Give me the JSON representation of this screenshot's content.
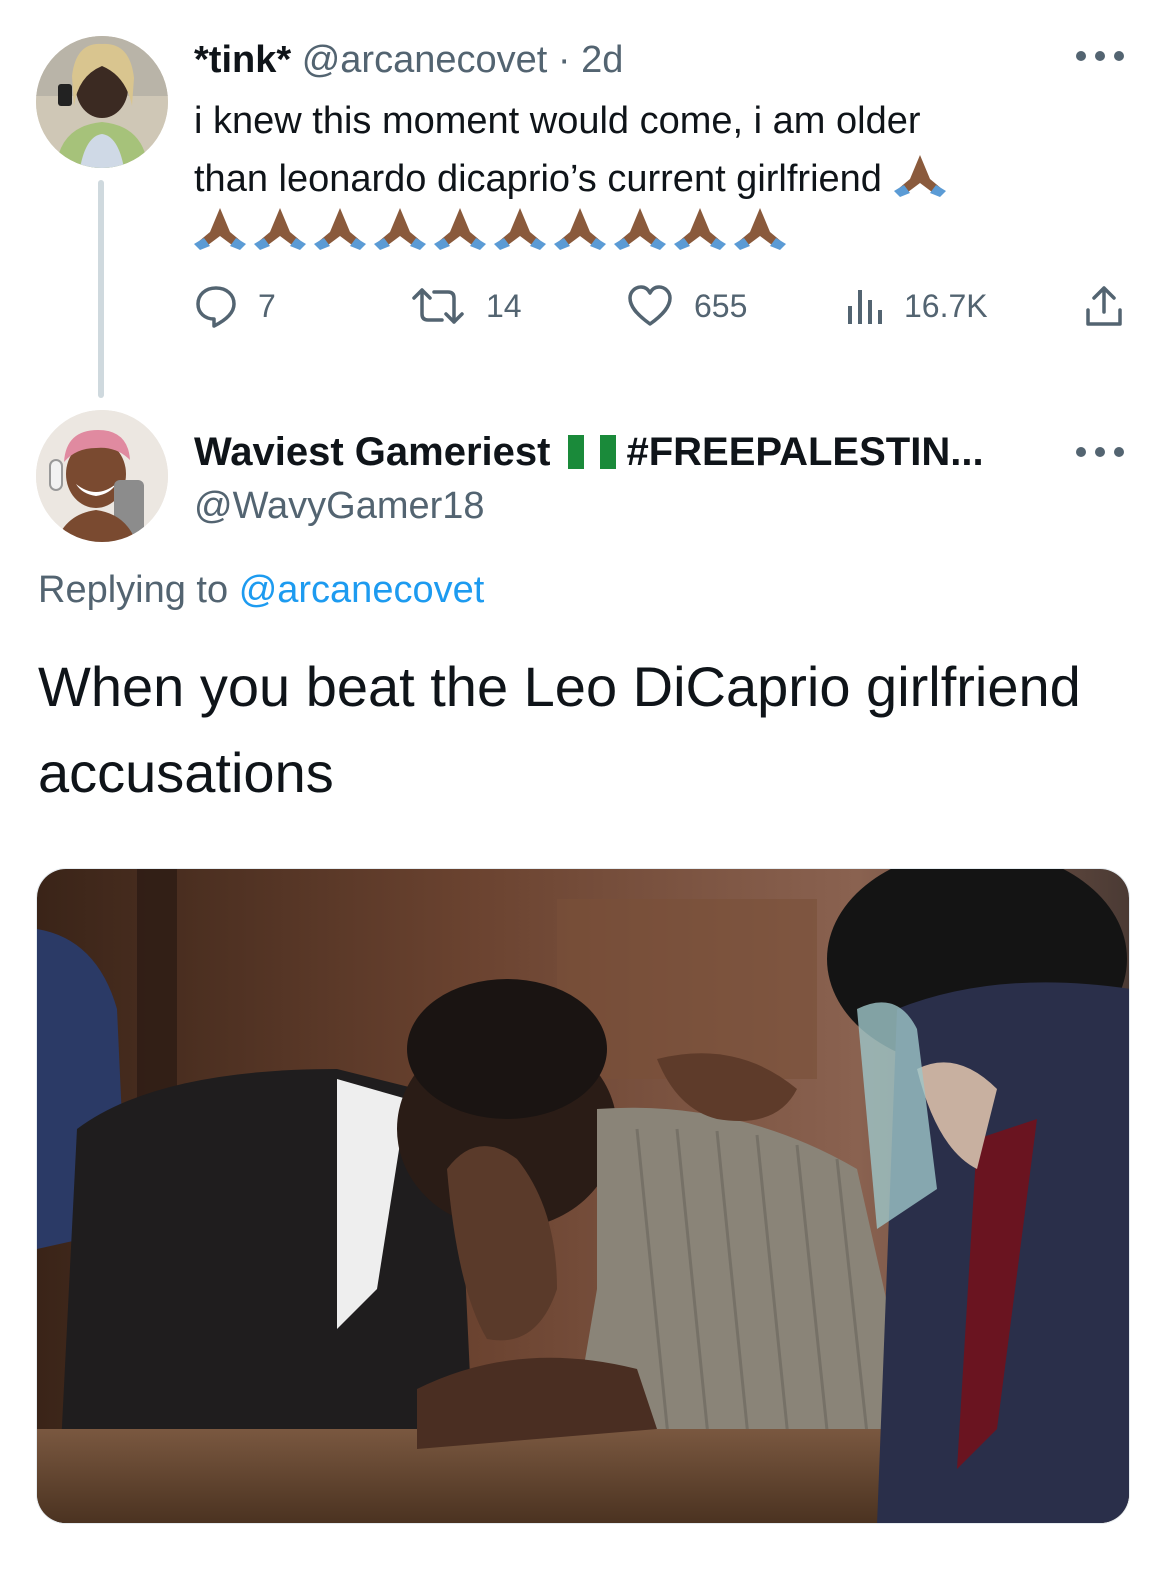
{
  "tweet": {
    "display_name": "*tink*",
    "handle": "@arcanecovet",
    "separator": "·",
    "time": "2d",
    "text_line1": "i knew this moment would come, i am older",
    "text_line2": "than leonardo dicaprio’s current girlfriend",
    "pray_emoji_count_line2": 10,
    "stats": {
      "replies": "7",
      "retweets": "14",
      "likes": "655",
      "views": "16.7K"
    }
  },
  "reply": {
    "display_name": "Waviest Gameriest",
    "display_name_suffix": "#FREEPALESTIN...",
    "handle": "@WavyGamer18",
    "replying_label": "Replying to",
    "replying_handle": "@arcanecovet",
    "text": "When you beat the Leo DiCaprio girlfriend accusations"
  },
  "colors": {
    "text": "#0f1419",
    "secondary": "#536471",
    "link": "#1d9bf0",
    "thread_line": "#cfd9de",
    "emoji_skin": "#8a5a3c",
    "emoji_sleeve": "#5b9bd5"
  },
  "icons": {
    "reply": "speech-bubble-icon",
    "retweet": "retweet-arrows-icon",
    "like": "heart-icon",
    "views": "bar-chart-icon",
    "share": "share-upload-icon",
    "more": "ellipsis-icon",
    "emoji": "folded-hands-emoji",
    "flag": "nigeria-flag-emoji"
  }
}
